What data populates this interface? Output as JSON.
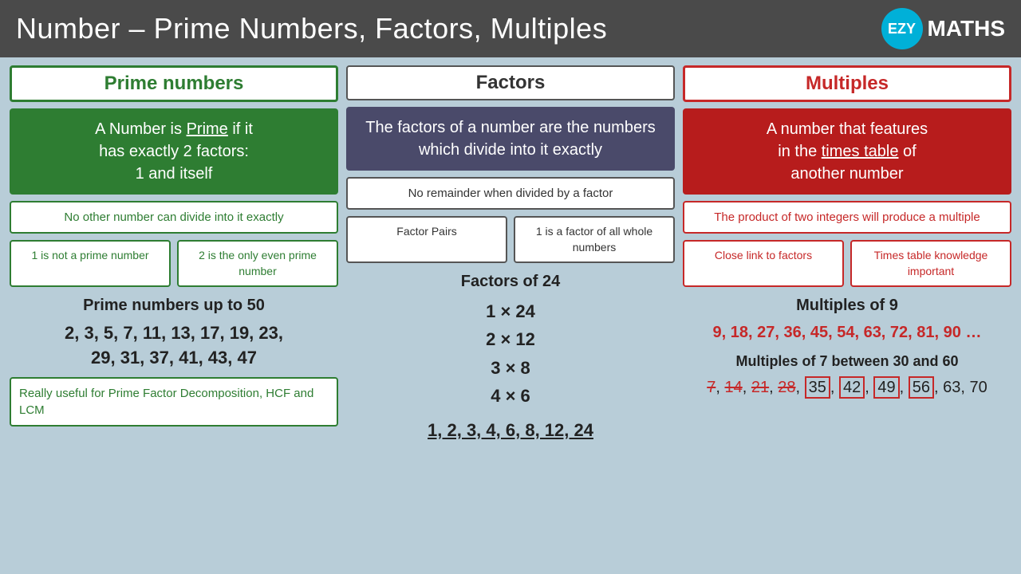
{
  "header": {
    "title": "Number – Prime Numbers, Factors, Multiples",
    "logo_text": "EZY",
    "logo_suffix": "MATHS"
  },
  "prime": {
    "section_title": "Prime numbers",
    "definition": "A Number is Prime if it has exactly 2 factors: 1 and itself",
    "definition_underline": "Prime",
    "note1": "No other number can divide into it exactly",
    "note2_left": "1 is not a prime number",
    "note2_right": "2 is the only even prime number",
    "list_title": "Prime numbers up to 50",
    "list": "2, 3, 5, 7, 11, 13, 17, 19, 23,\n29, 31, 37, 41, 43, 47",
    "footer": "Really useful for Prime Factor Decomposition, HCF and LCM"
  },
  "factors": {
    "section_title": "Factors",
    "definition": "The factors of a number are the numbers which divide into it exactly",
    "note1": "No remainder when divided by a factor",
    "note2_left": "Factor Pairs",
    "note2_right": "1 is a factor of all whole numbers",
    "list_title": "Factors of 24",
    "list": [
      "1 × 24",
      "2 × 12",
      "3 × 8",
      "4 × 6"
    ],
    "all_factors": "1, 2, 3, 4, 6, 8, 12, 24"
  },
  "multiples": {
    "section_title": "Multiples",
    "definition": "A number that features in the times table of another number",
    "definition_underline": "times table",
    "note1": "The product of two integers will produce a multiple",
    "note2_left": "Close link to factors",
    "note2_right": "Times table knowledge important",
    "list_title": "Multiples of 9",
    "list": "9, 18, 27, 36, 45, 54, 63, 72, 81, 90 …",
    "list2_title": "Multiples of 7 between 30 and 60",
    "list2": "7, 14, 21, 28, 35, 42, 49, 56, 63, 70"
  }
}
